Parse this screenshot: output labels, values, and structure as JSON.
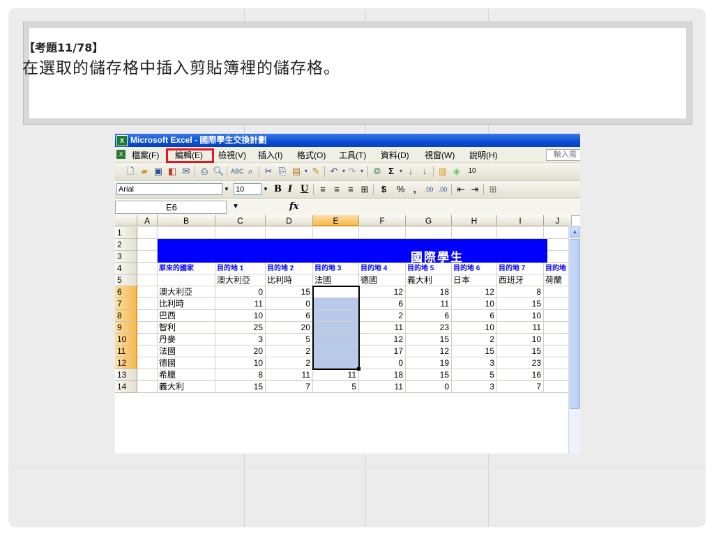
{
  "question": {
    "number": "【考題11/78】",
    "text": "在選取的儲存格中插入剪貼簿裡的儲存格。"
  },
  "excel": {
    "window_title": "Microsoft Excel - 國際學生交換計劃",
    "menu": [
      "檔案(F)",
      "編輯(E)",
      "檢視(V)",
      "插入(I)",
      "格式(O)",
      "工具(T)",
      "資料(D)",
      "視窗(W)",
      "說明(H)"
    ],
    "highlighted_menu": "編輯(E)",
    "help_placeholder": "輸入需",
    "zoom_partial": "10",
    "font_name": "Arial",
    "font_size": "10",
    "name_box": "E6",
    "fx_label": "fx",
    "columns": [
      "A",
      "B",
      "C",
      "D",
      "E",
      "F",
      "G",
      "H",
      "I",
      "J"
    ],
    "rows": [
      "1",
      "2",
      "3",
      "4",
      "5",
      "6",
      "7",
      "8",
      "9",
      "10",
      "11",
      "12",
      "13",
      "14"
    ],
    "banner_title": "國際學生",
    "header_row": [
      "原來的國家",
      "目的地 1",
      "目的地 2",
      "目的地 3",
      "目的地 4",
      "目的地 5",
      "目的地 6",
      "目的地 7",
      "目的地"
    ],
    "dest_countries": [
      "",
      "澳大利亞",
      "比利時",
      "法國",
      "德國",
      "義大利",
      "日本",
      "西班牙",
      "荷蘭"
    ],
    "data_rows": [
      {
        "name": "澳大利亞",
        "vals": [
          "0",
          "15",
          "",
          "12",
          "18",
          "12",
          "8"
        ]
      },
      {
        "name": "比利時",
        "vals": [
          "11",
          "0",
          "",
          "6",
          "11",
          "10",
          "15"
        ]
      },
      {
        "name": "巴西",
        "vals": [
          "10",
          "6",
          "",
          "2",
          "6",
          "6",
          "10"
        ]
      },
      {
        "name": "智利",
        "vals": [
          "25",
          "20",
          "",
          "11",
          "23",
          "10",
          "11"
        ]
      },
      {
        "name": "丹麥",
        "vals": [
          "3",
          "5",
          "",
          "12",
          "15",
          "2",
          "10"
        ]
      },
      {
        "name": "法國",
        "vals": [
          "20",
          "2",
          "",
          "17",
          "12",
          "15",
          "15"
        ]
      },
      {
        "name": "德國",
        "vals": [
          "10",
          "2",
          "",
          "0",
          "19",
          "3",
          "23"
        ]
      },
      {
        "name": "希臘",
        "vals": [
          "8",
          "11",
          "11",
          "18",
          "15",
          "5",
          "16"
        ]
      },
      {
        "name": "義大利",
        "vals": [
          "15",
          "7",
          "5",
          "11",
          "0",
          "3",
          "7"
        ]
      }
    ]
  }
}
